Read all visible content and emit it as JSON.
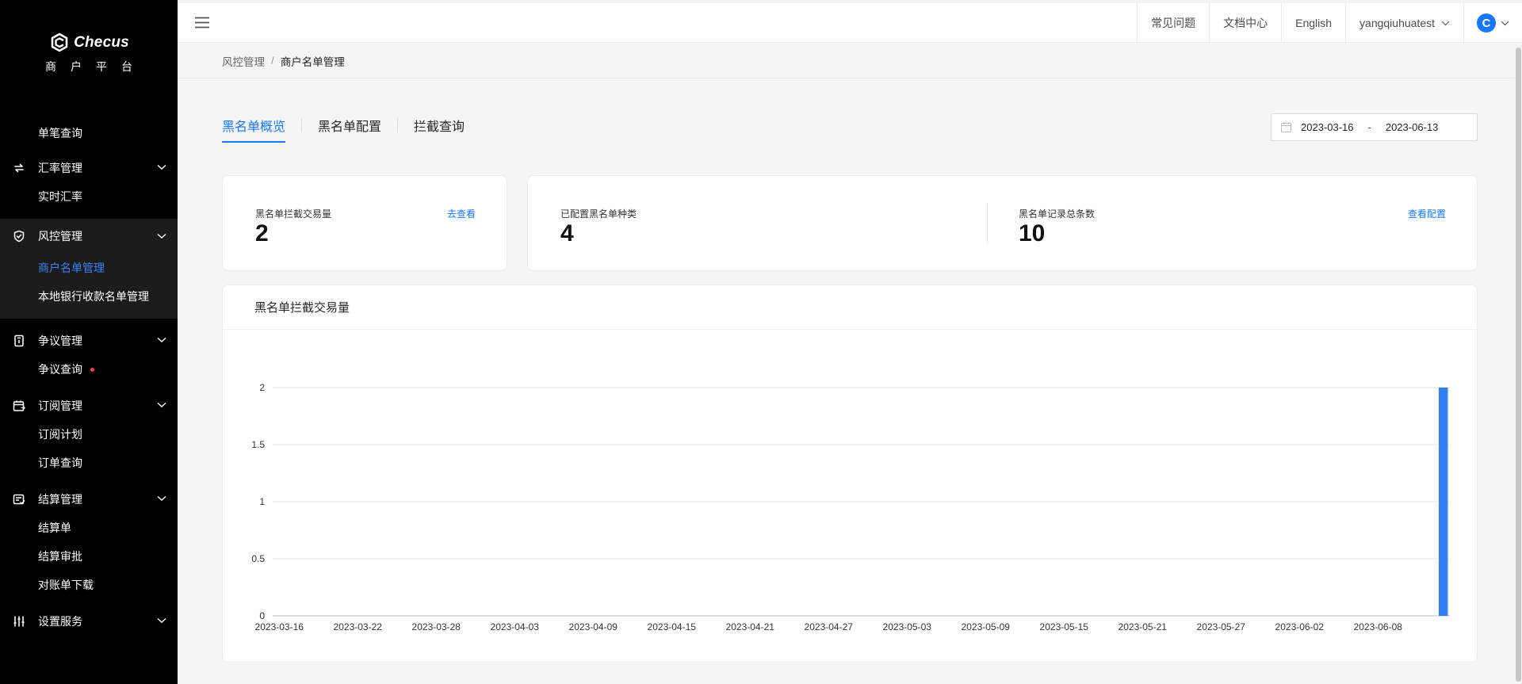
{
  "sidebar": {
    "logo_name": "Checus",
    "logo_sub": "商户平台",
    "top_item": "单笔查询",
    "groups": [
      {
        "title": "汇率管理",
        "icon": "exchange-icon",
        "items": [
          "实时汇率"
        ]
      },
      {
        "title": "风控管理",
        "icon": "shield-check-icon",
        "items": [
          "商户名单管理",
          "本地银行收款名单管理"
        ],
        "selected": "商户名单管理"
      },
      {
        "title": "争议管理",
        "icon": "dispute-icon",
        "items": [
          "争议查询"
        ]
      },
      {
        "title": "订阅管理",
        "icon": "calendar-icon",
        "items": [
          "订阅计划",
          "订单查询"
        ]
      },
      {
        "title": "结算管理",
        "icon": "settlement-icon",
        "items": [
          "结算单",
          "结算审批",
          "对账单下载"
        ]
      },
      {
        "title": "设置服务",
        "icon": "sliders-icon",
        "items": []
      }
    ]
  },
  "header": {
    "faq": "常见问题",
    "docs": "文档中心",
    "language": "English",
    "user": "yangqiuhuatest",
    "avatar_letter": "C"
  },
  "breadcrumb": {
    "parent": "风控管理",
    "current": "商户名单管理"
  },
  "tabs": [
    "黑名单概览",
    "黑名单配置",
    "拦截查询"
  ],
  "date_range": {
    "start": "2023-03-16",
    "separator": "-",
    "end": "2023-06-13"
  },
  "stats": {
    "intercept": {
      "label": "黑名单拦截交易量",
      "value": "2",
      "link": "去查看"
    },
    "types": {
      "label": "已配置黑名单种类",
      "value": "4"
    },
    "records": {
      "label": "黑名单记录总条数",
      "value": "10",
      "link": "查看配置"
    }
  },
  "chart_card_title": "黑名单拦截交易量",
  "colors": {
    "accent": "#1677ff",
    "bar": "#2f7ff5"
  },
  "chart_data": {
    "type": "bar",
    "title": "黑名单拦截交易量",
    "xlabel": "",
    "ylabel": "",
    "ylim": [
      0,
      2
    ],
    "yticks": [
      "0",
      "0.5",
      "1",
      "1.5",
      "2"
    ],
    "grid": true,
    "x_tick_labels": [
      "2023-03-16",
      "2023-03-22",
      "2023-03-28",
      "2023-04-03",
      "2023-04-09",
      "2023-04-15",
      "2023-04-21",
      "2023-04-27",
      "2023-05-03",
      "2023-05-09",
      "2023-05-15",
      "2023-05-21",
      "2023-05-27",
      "2023-06-02",
      "2023-06-08"
    ],
    "x_start": "2023-03-16",
    "x_end": "2023-06-13",
    "bars": [
      {
        "date": "2023-06-13",
        "value": 2
      }
    ]
  }
}
